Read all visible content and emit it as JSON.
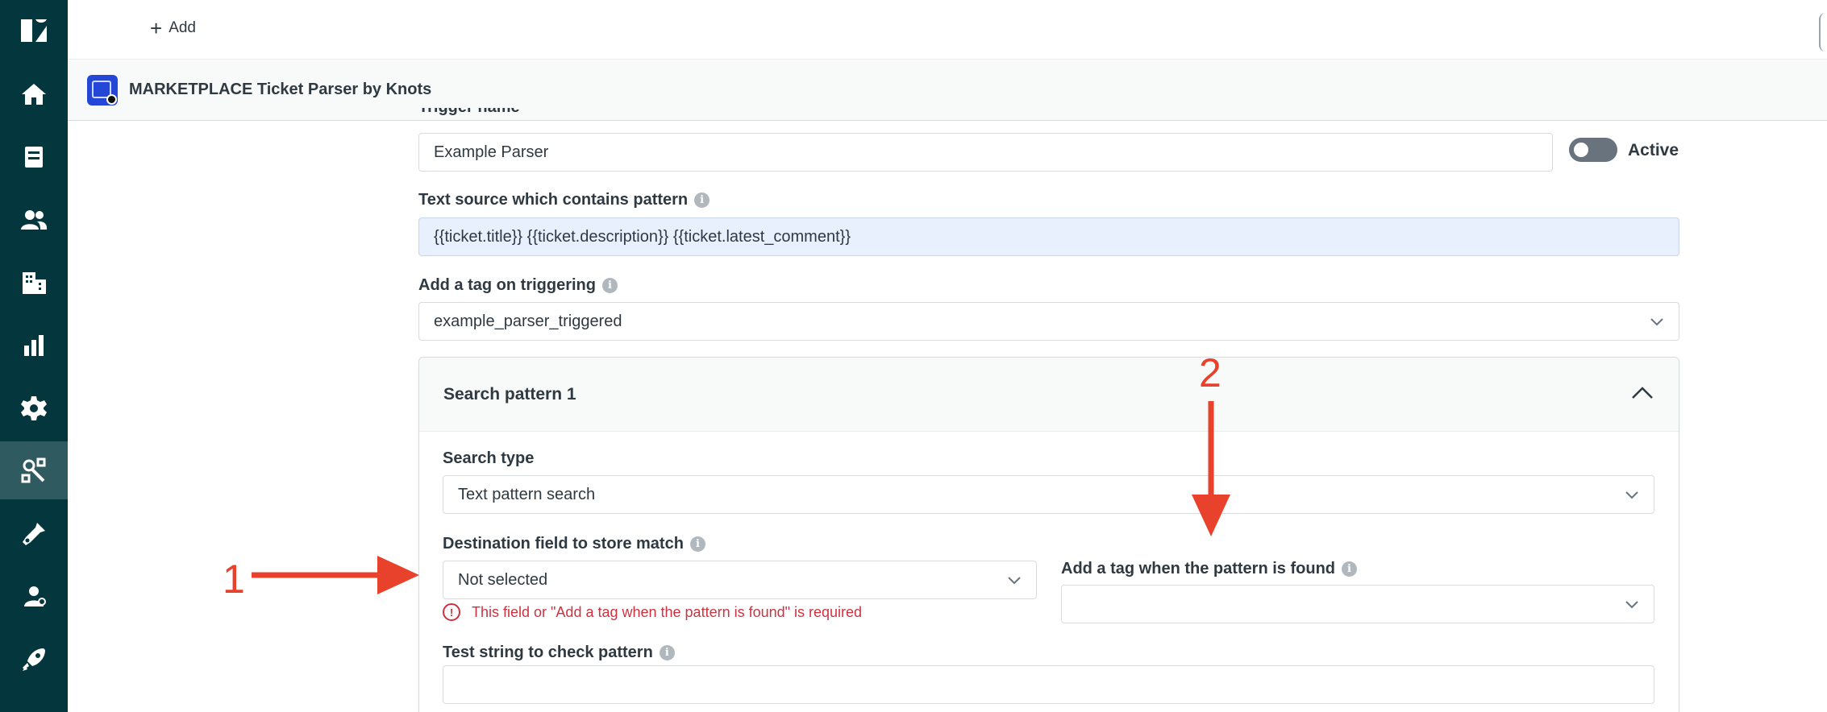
{
  "topbar": {
    "add_label": "Add"
  },
  "app": {
    "title": "MARKETPLACE Ticket Parser by Knots"
  },
  "sidebar": {
    "items": [
      {
        "icon": "logo-icon"
      },
      {
        "icon": "home-icon"
      },
      {
        "icon": "views-icon"
      },
      {
        "icon": "customers-icon"
      },
      {
        "icon": "organizations-icon"
      },
      {
        "icon": "reporting-icon"
      },
      {
        "icon": "admin-gear-icon"
      },
      {
        "icon": "apps-icon",
        "active": true
      },
      {
        "icon": "app-tool-icon"
      },
      {
        "icon": "app-integration-icon"
      },
      {
        "icon": "rocket-icon"
      }
    ]
  },
  "form": {
    "trigger_name_label": "Trigger name",
    "trigger_name_value": "Example Parser",
    "active_label": "Active",
    "text_source_label": "Text source which contains pattern",
    "text_source_value": "{{ticket.title}} {{ticket.description}} {{ticket.latest_comment}}",
    "add_tag_label": "Add a tag on triggering",
    "add_tag_value": "example_parser_triggered",
    "pattern": {
      "title": "Search pattern 1",
      "search_type_label": "Search type",
      "search_type_value": "Text pattern search",
      "destination_label": "Destination field to store match",
      "destination_value": "Not selected",
      "error_text": "This field or \"Add a tag when the pattern is found\" is required",
      "tag_found_label": "Add a tag when the pattern is found",
      "tag_found_value": "",
      "test_string_label": "Test string to check pattern",
      "test_string_value": ""
    }
  },
  "annotations": {
    "one": "1",
    "two": "2",
    "color": "#e8412c"
  }
}
